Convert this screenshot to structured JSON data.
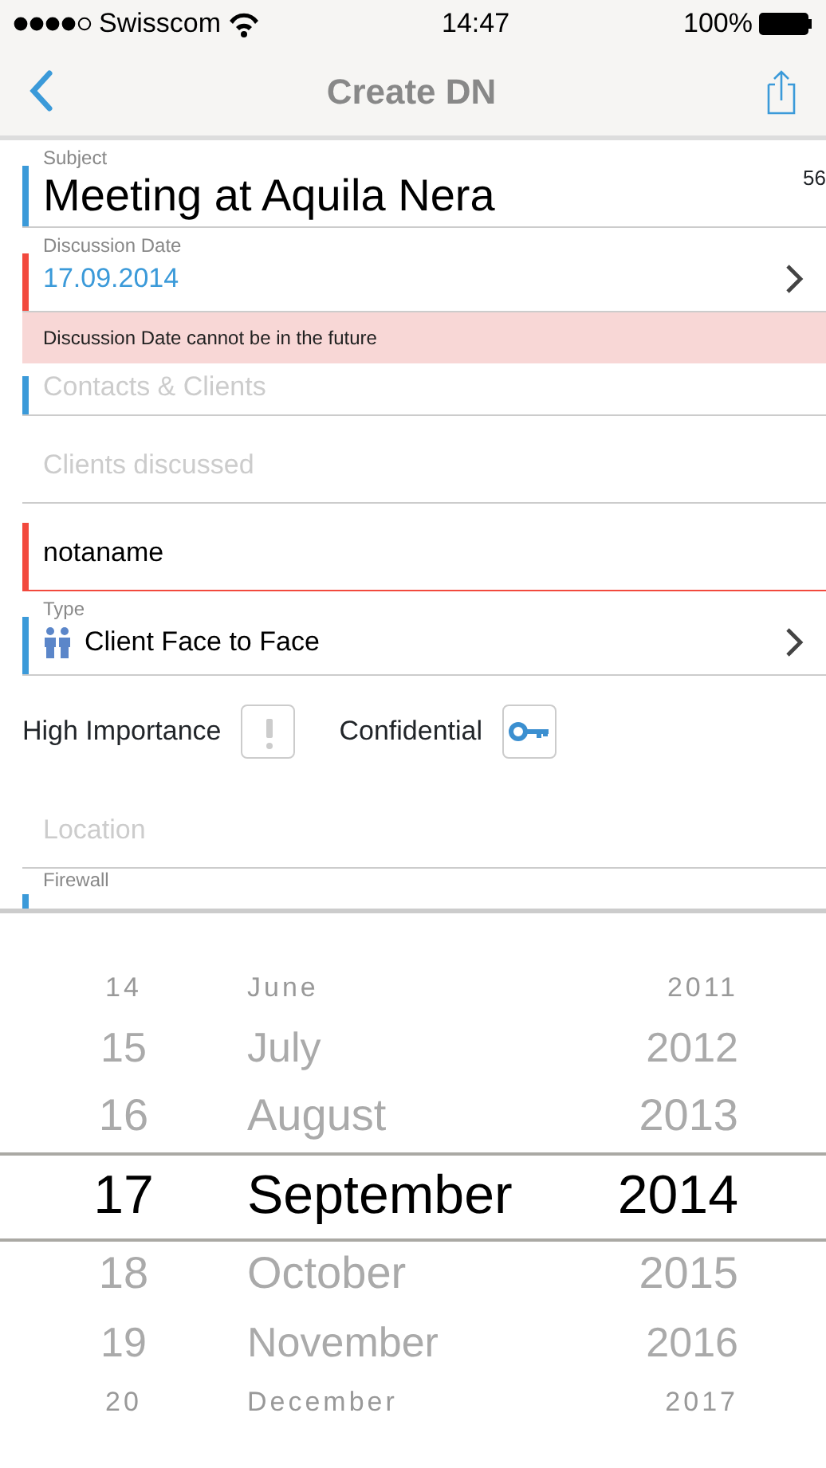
{
  "status_bar": {
    "carrier": "Swisscom",
    "time": "14:47",
    "battery": "100%"
  },
  "nav": {
    "title": "Create DN"
  },
  "fields": [
    {
      "kind": "subject",
      "label": "Subject",
      "value": "Meeting at Aquila Nera",
      "counter": "56",
      "required": true,
      "invalid": false
    },
    {
      "kind": "select",
      "label": "Discussion Date",
      "value": "17.09.2014",
      "required": false,
      "invalid": true,
      "error": "Discussion Date cannot be in the future"
    },
    {
      "kind": "text",
      "placeholder": "Contacts & Clients",
      "required": true,
      "invalid": false
    },
    {
      "kind": "text",
      "placeholder": "Clients discussed",
      "required": false,
      "invalid": false
    },
    {
      "kind": "text",
      "value": "notaname",
      "required": false,
      "invalid": true
    },
    {
      "kind": "type_select",
      "label": "Type",
      "value": "Client Face to Face",
      "required": true,
      "invalid": false
    },
    {
      "kind": "toggles",
      "toggles": [
        {
          "kind": "importance",
          "label": "High Importance",
          "on": false
        },
        {
          "kind": "confidential",
          "label": "Confidential",
          "on": true
        }
      ]
    },
    {
      "kind": "text",
      "placeholder": "Location",
      "required": false,
      "invalid": false
    },
    {
      "kind": "cut",
      "label": "Firewall",
      "required": true,
      "invalid": false
    }
  ],
  "picker": {
    "columns": [
      {
        "items": [
          {
            "text": "14",
            "selected": false
          },
          {
            "text": "15",
            "selected": false
          },
          {
            "text": "16",
            "selected": false
          },
          {
            "text": "17",
            "selected": true
          },
          {
            "text": "18",
            "selected": false
          },
          {
            "text": "19",
            "selected": false
          },
          {
            "text": "20",
            "selected": false
          }
        ]
      },
      {
        "items": [
          {
            "text": "June",
            "selected": false
          },
          {
            "text": "July",
            "selected": false
          },
          {
            "text": "August",
            "selected": false
          },
          {
            "text": "September",
            "selected": true
          },
          {
            "text": "October",
            "selected": false
          },
          {
            "text": "November",
            "selected": false
          },
          {
            "text": "December",
            "selected": false
          }
        ]
      },
      {
        "items": [
          {
            "text": "2011",
            "selected": false
          },
          {
            "text": "2012",
            "selected": false
          },
          {
            "text": "2013",
            "selected": false
          },
          {
            "text": "2014",
            "selected": true
          },
          {
            "text": "2015",
            "selected": false
          },
          {
            "text": "2016",
            "selected": false
          },
          {
            "text": "2017",
            "selected": false
          }
        ]
      }
    ]
  }
}
